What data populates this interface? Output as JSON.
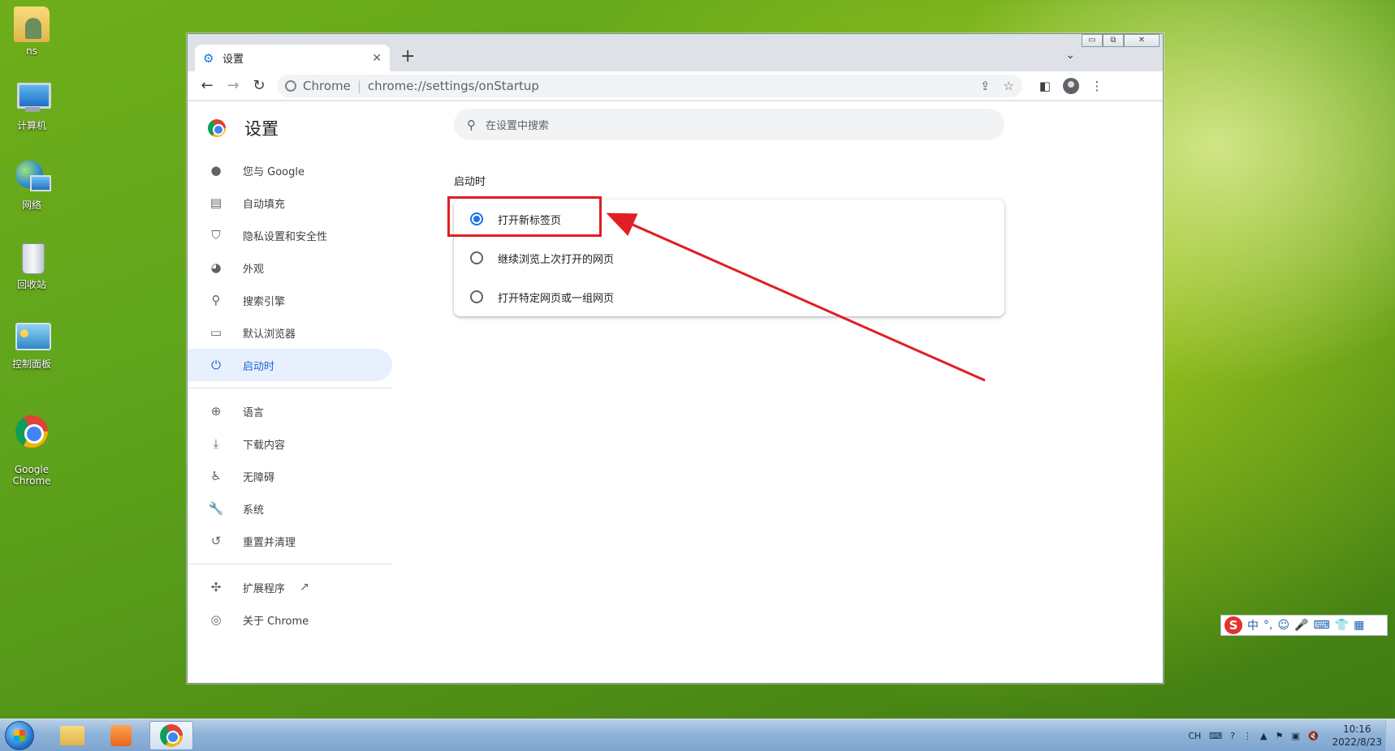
{
  "desktop": {
    "icons": [
      {
        "label": "ns",
        "icon": "user-folder-icon"
      },
      {
        "label": "计算机",
        "icon": "computer-icon"
      },
      {
        "label": "网络",
        "icon": "network-icon"
      },
      {
        "label": "回收站",
        "icon": "recycle-bin-icon"
      },
      {
        "label": "控制面板",
        "icon": "control-panel-icon"
      },
      {
        "label": "Google\nChrome",
        "icon": "chrome-icon"
      }
    ]
  },
  "window": {
    "controls": {
      "minimize": "▭",
      "restore": "⧉",
      "close": "✕"
    }
  },
  "tab": {
    "title": "设置",
    "icon": "settings-gear-icon",
    "close": "✕"
  },
  "toolbar": {
    "site_name": "Chrome",
    "url": "chrome://settings/onStartup",
    "new_tab": "+",
    "tab_menu": "⌄"
  },
  "settings": {
    "title": "设置",
    "search_placeholder": "在设置中搜索",
    "nav": [
      {
        "label": "您与 Google",
        "icon": "person-icon"
      },
      {
        "label": "自动填充",
        "icon": "clipboard-icon"
      },
      {
        "label": "隐私设置和安全性",
        "icon": "shield-icon"
      },
      {
        "label": "外观",
        "icon": "palette-icon"
      },
      {
        "label": "搜索引擎",
        "icon": "search-icon"
      },
      {
        "label": "默认浏览器",
        "icon": "browser-icon"
      },
      {
        "label": "启动时",
        "icon": "power-icon"
      },
      {
        "label": "语言",
        "icon": "globe-icon"
      },
      {
        "label": "下载内容",
        "icon": "download-icon"
      },
      {
        "label": "无障碍",
        "icon": "accessibility-icon"
      },
      {
        "label": "系统",
        "icon": "wrench-icon"
      },
      {
        "label": "重置并清理",
        "icon": "history-icon"
      },
      {
        "label": "扩展程序",
        "icon": "puzzle-icon"
      },
      {
        "label": "关于 Chrome",
        "icon": "chrome-outline-icon"
      }
    ],
    "active_nav": "启动时",
    "section_title": "启动时",
    "options": [
      {
        "label": "打开新标签页",
        "checked": true
      },
      {
        "label": "继续浏览上次打开的网页",
        "checked": false
      },
      {
        "label": "打开特定网页或一组网页",
        "checked": false
      }
    ]
  },
  "annotation": {
    "color": "#e01e24"
  },
  "ime": {
    "items": [
      "中",
      "°,",
      "☺",
      "🎤",
      "⌨",
      "👕",
      "▦"
    ]
  },
  "taskbar": {
    "lang": "CH",
    "time": "10:16",
    "date": "2022/8/23"
  },
  "colors": {
    "accent": "#1a73e8",
    "active_nav_bg": "#e8f0fe"
  }
}
